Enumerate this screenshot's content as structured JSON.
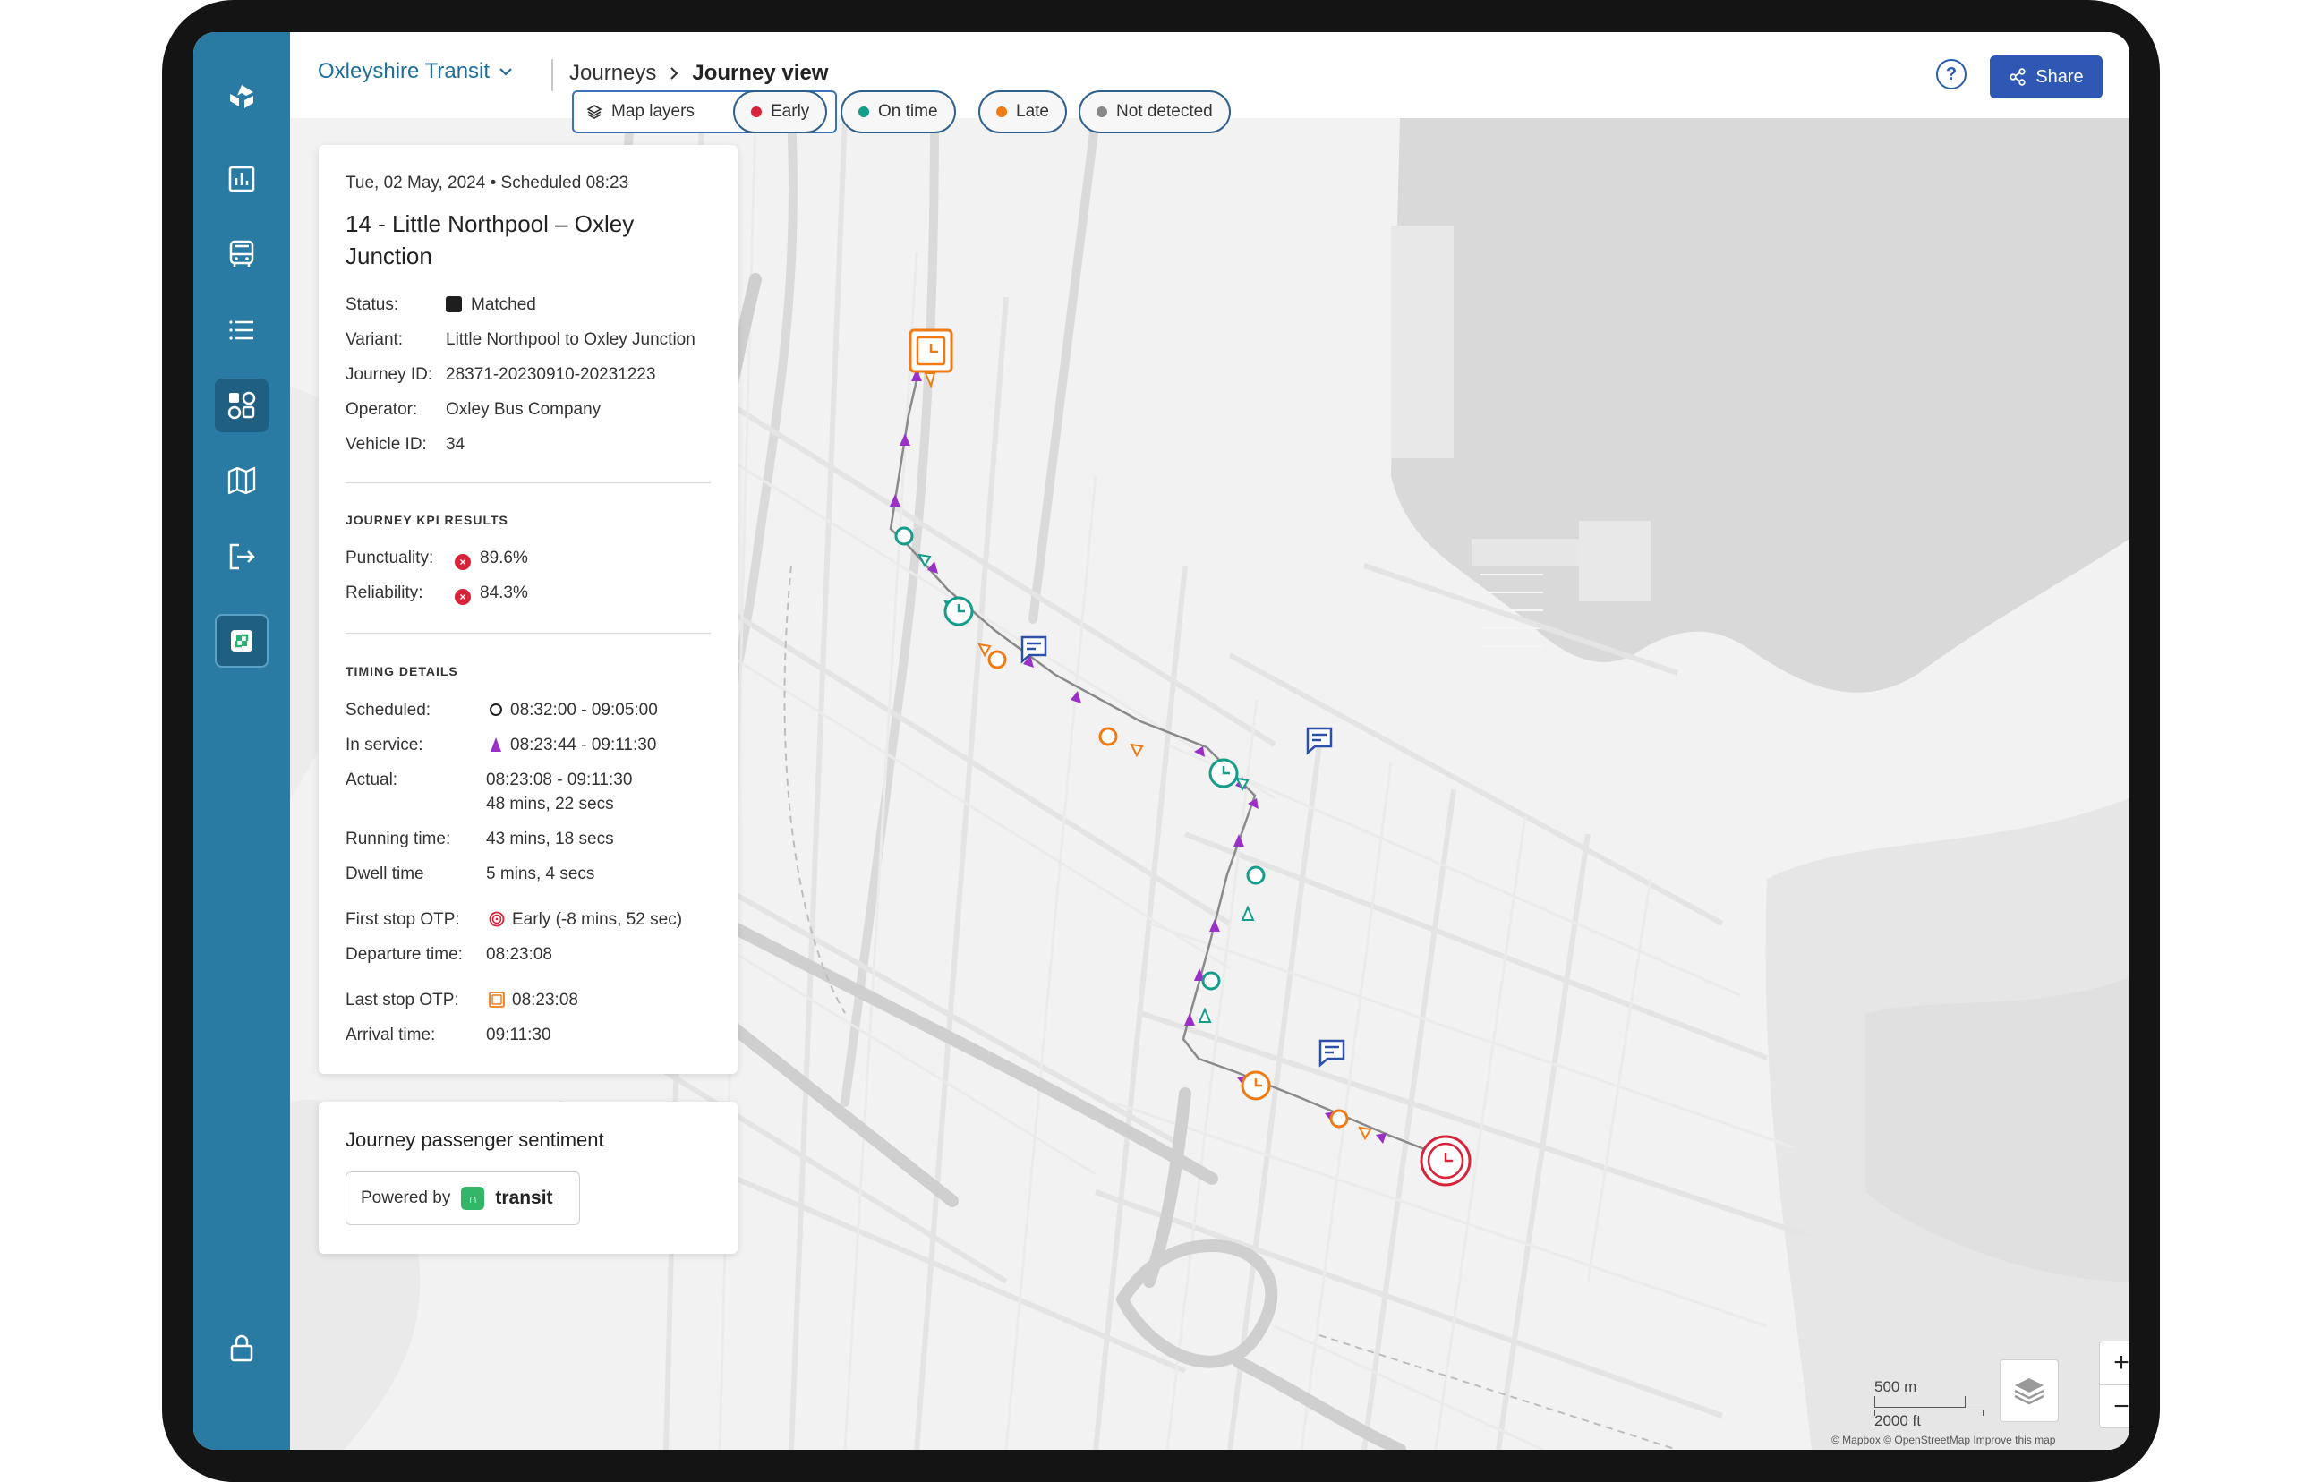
{
  "header": {
    "org_name": "Oxleyshire Transit",
    "breadcrumb": [
      "Journeys",
      "Journey view"
    ],
    "help_label": "?",
    "share_label": "Share"
  },
  "sidebar": {
    "items": [
      {
        "icon": "logo-icon"
      },
      {
        "icon": "chart-icon"
      },
      {
        "icon": "bus-icon"
      },
      {
        "icon": "list-icon"
      },
      {
        "icon": "dashboard-icon",
        "active": true
      },
      {
        "icon": "map-icon"
      },
      {
        "icon": "logout-icon"
      },
      {
        "icon": "app-icon"
      },
      {
        "icon": "lock-icon"
      }
    ]
  },
  "map_controls": {
    "layers_label": "Map layers",
    "legend": [
      "Early",
      "On time",
      "Late",
      "Not detected"
    ],
    "legend_colors": [
      "#d8233a",
      "#159c8a",
      "#f07a14",
      "#888888"
    ],
    "zoom_in": "+",
    "zoom_out": "−",
    "scale_metric": "500 m",
    "scale_imperial": "2000 ft",
    "attribution": "© Mapbox © OpenStreetMap Improve this map"
  },
  "journey": {
    "date_line": "Tue, 02 May, 2024 • Scheduled 08:23",
    "title": "14 - Little Northpool – Oxley Junction",
    "status_label": "Status:",
    "status": "Matched",
    "variant_label": "Variant:",
    "variant": "Little Northpool to Oxley Junction",
    "journey_id_label": "Journey ID:",
    "journey_id": "28371-20230910-20231223",
    "operator_label": "Operator:",
    "operator": "Oxley Bus Company",
    "vehicle_id_label": "Vehicle ID:",
    "vehicle_id": "34",
    "kpi_heading": "JOURNEY KPI RESULTS",
    "punctuality_label": "Punctuality:",
    "punctuality": "89.6%",
    "reliability_label": "Reliability:",
    "reliability": "84.3%",
    "timing_heading": "TIMING DETAILS",
    "scheduled_label": "Scheduled:",
    "scheduled": "08:32:00 - 09:05:00",
    "in_service_label": "In service:",
    "in_service": "08:23:44 - 09:11:30",
    "actual_label": "Actual:",
    "actual": "08:23:08 - 09:11:30",
    "actual_duration": "48 mins, 22 secs",
    "running_label": "Running time:",
    "running": "43 mins, 18 secs",
    "dwell_label": "Dwell time",
    "dwell": "5 mins, 4 secs",
    "first_otp_label": "First stop OTP:",
    "first_otp": "Early (-8 mins, 52 sec)",
    "departure_label": "Departure time:",
    "departure": "08:23:08",
    "last_otp_label": "Last stop OTP:",
    "last_otp": "08:23:08",
    "arrival_label": "Arrival time:",
    "arrival": "09:11:30"
  },
  "sentiment": {
    "title": "Journey passenger sentiment",
    "powered_by": "Powered by",
    "brand": "transit"
  }
}
